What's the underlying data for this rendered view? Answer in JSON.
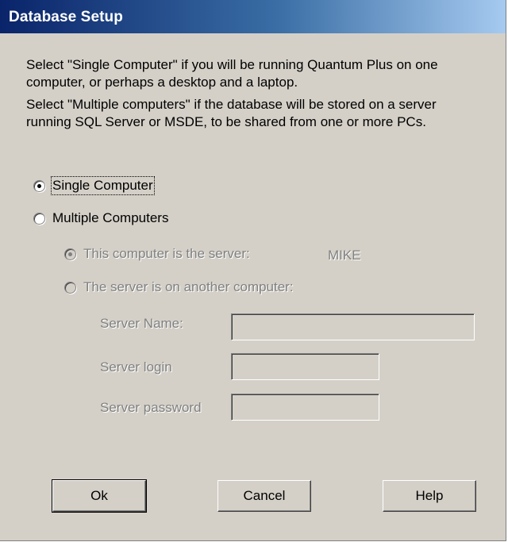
{
  "window": {
    "title": "Database Setup"
  },
  "intro": {
    "line1": "Select \"Single Computer\" if you will be running Quantum Plus on one computer, or perhaps a desktop and a laptop.",
    "line2": "Select \"Multiple computers\" if the database will be stored on a server running SQL Server or MSDE, to be shared from one or more PCs."
  },
  "mode": {
    "single_label": "Single Computer",
    "multiple_label": "Multiple Computers",
    "selected": "single"
  },
  "server_location": {
    "this_computer_label": "This computer is the server:",
    "this_computer_name": "MIKE",
    "other_computer_label": "The server is on another computer:",
    "selected": "this"
  },
  "fields": {
    "server_name_label": "Server Name:",
    "server_name_value": "",
    "server_login_label": "Server login",
    "server_login_value": "",
    "server_password_label": "Server password",
    "server_password_value": ""
  },
  "buttons": {
    "ok": "Ok",
    "cancel": "Cancel",
    "help": "Help"
  },
  "colors": {
    "dialog_bg": "#d4d0c8",
    "titlebar_start": "#0a246a",
    "titlebar_end": "#a6caf0",
    "disabled_text": "#808080"
  }
}
